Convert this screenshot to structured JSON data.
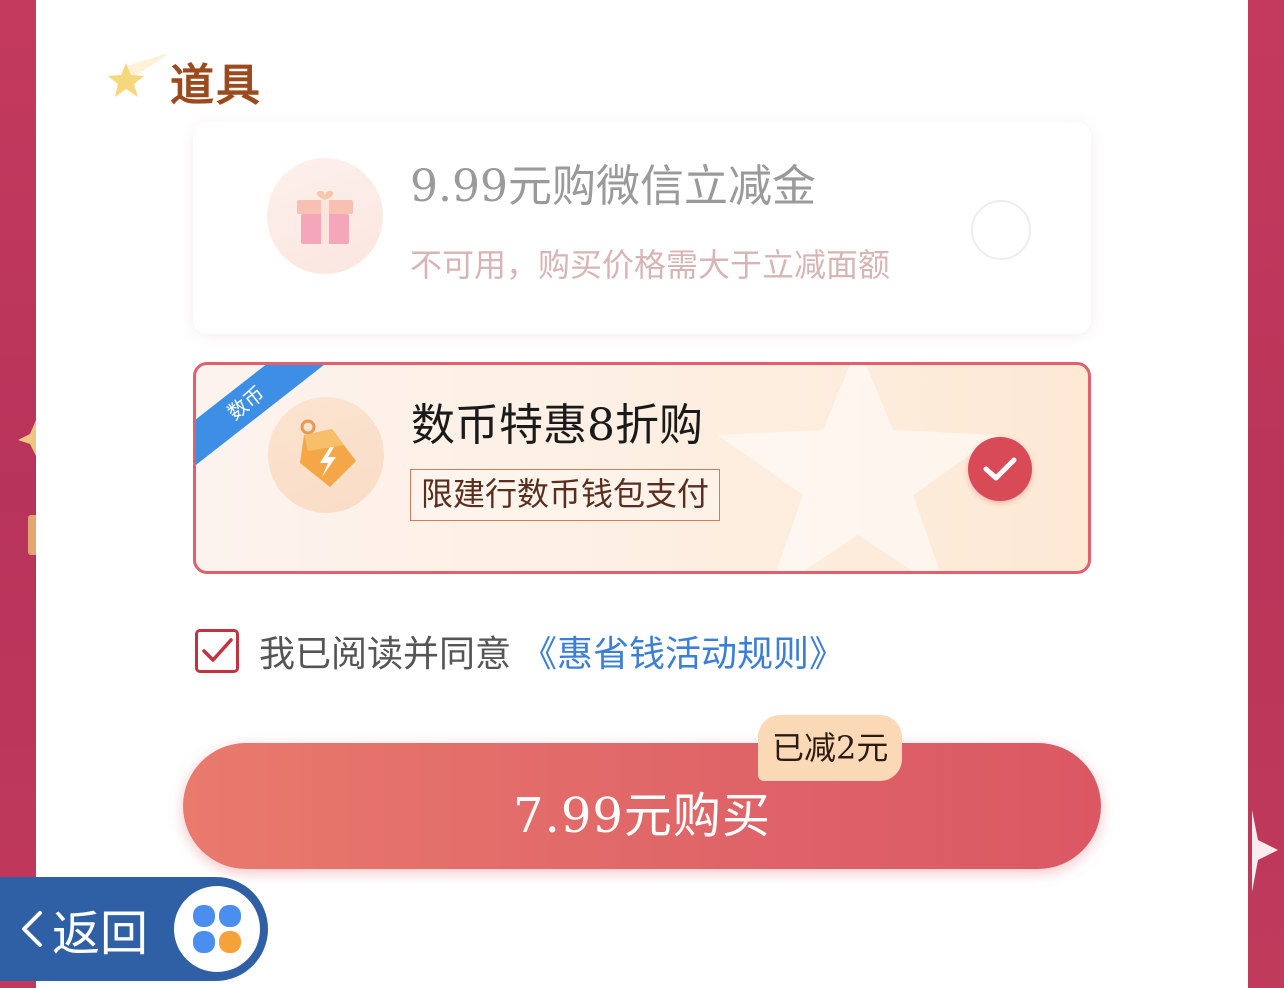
{
  "section": {
    "title": "道具"
  },
  "coupon_disabled": {
    "title": "9.99元购微信立减金",
    "subtitle": "不可用，购买价格需大于立减面额",
    "icon": "gift-icon",
    "selected": false,
    "enabled": false
  },
  "coupon_selected": {
    "corner_badge": "数币",
    "title": "数币特惠8折购",
    "tag": "限建行数币钱包支付",
    "icon": "price-tag-icon",
    "selected": true
  },
  "agreement": {
    "checked": true,
    "text": "我已阅读并同意",
    "link": "《惠省钱活动规则》"
  },
  "purchase": {
    "button_label": "7.99元购买",
    "discount_badge": "已减2元"
  },
  "nav": {
    "back_label": "返回",
    "app_icon": "four-petal-app-icon"
  },
  "colors": {
    "accent_red": "#d94a57",
    "link_blue": "#3b7fd6",
    "ribbon_blue": "#3d8fe6",
    "title_brown": "#9b4a1e",
    "back_pill": "#2f5fa5"
  }
}
